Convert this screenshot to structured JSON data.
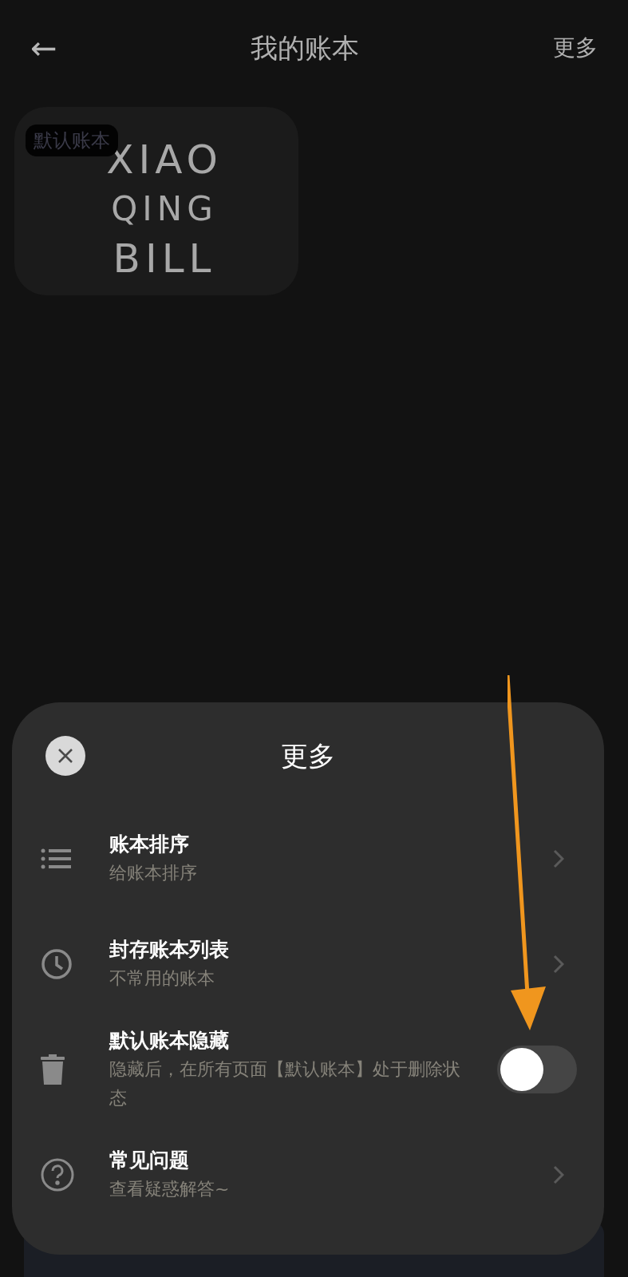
{
  "header": {
    "back": "←",
    "title": "我的账本",
    "more": "更多"
  },
  "books": [
    {
      "badge": "默认账本",
      "logo": [
        "XIAO",
        "QING",
        "BILL"
      ]
    }
  ],
  "sheet": {
    "title": "更多",
    "items": [
      {
        "kind": "link",
        "title": "账本排序",
        "subtitle": "给账本排序"
      },
      {
        "kind": "link",
        "title": "封存账本列表",
        "subtitle": "不常用的账本"
      },
      {
        "kind": "toggle",
        "title": "默认账本隐藏",
        "subtitle": "隐藏后，在所有页面【默认账本】处于删除状态",
        "on": false
      },
      {
        "kind": "link",
        "title": "常见问题",
        "subtitle": "查看疑惑解答~"
      }
    ]
  }
}
